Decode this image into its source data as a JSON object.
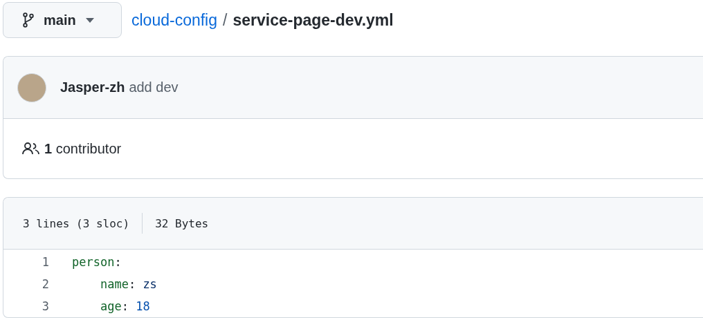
{
  "branch": {
    "name": "main"
  },
  "breadcrumb": {
    "repo": "cloud-config",
    "separator": "/",
    "file": "service-page-dev.yml"
  },
  "commit": {
    "author": "Jasper-zh",
    "message": "add dev"
  },
  "contributors": {
    "count": "1",
    "label": "contributor"
  },
  "file_info": {
    "lines": "3 lines (3 sloc)",
    "size": "32 Bytes"
  },
  "code_lines": [
    {
      "number": "1",
      "tokens": [
        {
          "kind": "key",
          "text": "person"
        },
        {
          "kind": "punct",
          "text": ":"
        }
      ]
    },
    {
      "number": "2",
      "tokens": [
        {
          "kind": "key",
          "text": "    name"
        },
        {
          "kind": "punct",
          "text": ": "
        },
        {
          "kind": "string",
          "text": "zs"
        }
      ]
    },
    {
      "number": "3",
      "tokens": [
        {
          "kind": "key",
          "text": "    age"
        },
        {
          "kind": "punct",
          "text": ": "
        },
        {
          "kind": "number",
          "text": "18"
        }
      ]
    }
  ]
}
